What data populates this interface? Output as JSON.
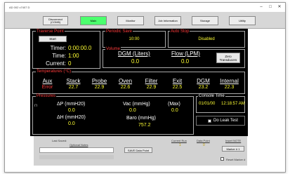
{
  "window": {
    "title": "AD 002 v7407 D",
    "minimize": "–",
    "maximize": "□",
    "close": "✕"
  },
  "nav": {
    "disconnect": "Disconnect (COM5)",
    "main": "Main",
    "monitor": "Monitor",
    "job_information": "Job Information",
    "storage": "Storage",
    "utility": "Utility"
  },
  "traverse": {
    "title": "Traverse Point",
    "start_label": "Start",
    "timer_label": "Timer:",
    "timer_value": "0:00:00.0",
    "time_label": "Time:",
    "time_value": "1:00",
    "current_label": "Current:",
    "current_value": "0"
  },
  "periodic_save": {
    "title": "Periodic Save",
    "value": "10:00"
  },
  "auto_stop": {
    "title": "Auto Stop",
    "value": "Disabled"
  },
  "volume": {
    "title": "Volume",
    "dgm_label": "DGM (Liters)",
    "dgm_value": "0.0",
    "flow_label": "Flow (LPM)",
    "flow_value": "0.0",
    "zero_button": "Zero Transducers"
  },
  "temperatures": {
    "title": "Temperatures (°C)",
    "columns": [
      {
        "label": "Aux",
        "value": "Error",
        "value_color": "#ff3b3b"
      },
      {
        "label": "Stack",
        "value": "22.7",
        "value_color": "#ffff33"
      },
      {
        "label": "Probe",
        "value": "22.9",
        "value_color": "#ffff33"
      },
      {
        "label": "Oven",
        "value": "22.6",
        "value_color": "#ffff33"
      },
      {
        "label": "Filter",
        "value": "22.9",
        "value_color": "#ffff33"
      },
      {
        "label": "Exit",
        "value": "22.5",
        "value_color": "#ffff33"
      },
      {
        "label": "DGM",
        "value": "23.2",
        "value_color": "#ffff33"
      },
      {
        "label": "Internal",
        "value": "22.3",
        "value_color": "#ffff33"
      }
    ]
  },
  "pressures": {
    "title": "Pressures",
    "side_label": "(\")",
    "dp_label": "ΔP (mmH20)",
    "dp_value": "0.0",
    "dh_label": "ΔH (mmH20)",
    "dh_value": "0.0",
    "vac_label": "Vac (mmHg)",
    "vac_value": "0.0",
    "max_label": "(Max)",
    "max_value": "0.0",
    "baro_label": "Baro (mmHg)",
    "baro_value": "757.2"
  },
  "console": {
    "title": "Console Time",
    "date": "01/01/00",
    "time": "12:18:57 AM",
    "leak_test_label": "Do Leak Test"
  },
  "footer": {
    "last_saved_label": "Last Saved:",
    "optional_notes_label": "Optional Notes",
    "save_button": "SAVE Data Point",
    "current_run_label": "Current Run",
    "current_run_value": "1",
    "data_point_label": "Data Point",
    "data_point_value": "0",
    "insert_note_label": "Insert NOTE",
    "marker_button": "Marker # 1",
    "reset_marker_label": "Reset Marker #"
  }
}
